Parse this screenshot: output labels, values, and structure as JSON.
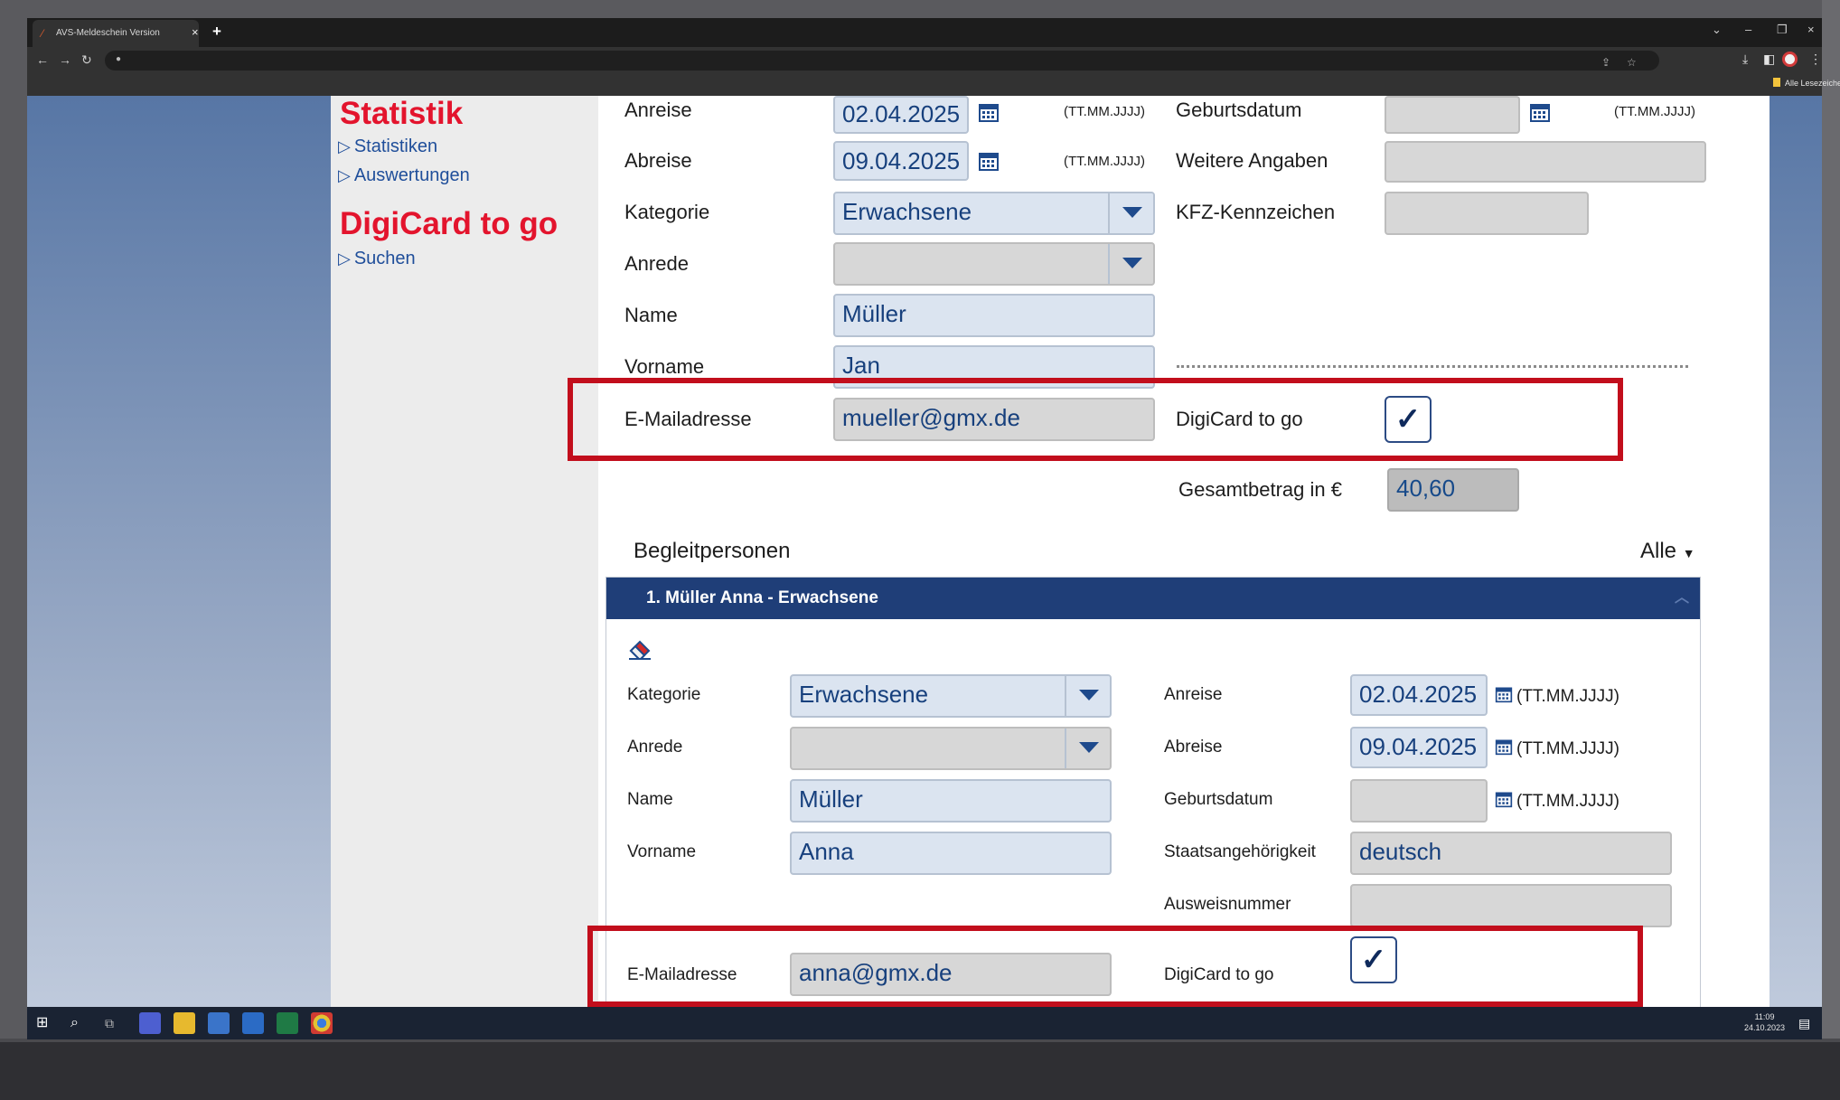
{
  "browser": {
    "tab_title": "AVS-Meldeschein Version",
    "tab_close": "×",
    "new_tab": "+",
    "window_controls": [
      "⌄",
      "–",
      "❐",
      "×"
    ],
    "bookmark_label": "Alle Lesezeichen"
  },
  "sidebar": {
    "section1_title": "Statistik",
    "section1_links": [
      "Statistiken",
      "Auswertungen"
    ],
    "section2_title": "DigiCard to go",
    "section2_links": [
      "Suchen"
    ]
  },
  "main": {
    "anreise_label": "Anreise",
    "anreise_value": "02.04.2025",
    "abreise_label": "Abreise",
    "abreise_value": "09.04.2025",
    "date_hint": "(TT.MM.JJJJ)",
    "kategorie_label": "Kategorie",
    "kategorie_value": "Erwachsene",
    "anrede_label": "Anrede",
    "anrede_value": "",
    "name_label": "Name",
    "name_value": "Müller",
    "vorname_label": "Vorname",
    "vorname_value": "Jan",
    "email_label": "E-Mailadresse",
    "email_value": "mueller@gmx.de",
    "geburtsdatum_label": "Geburtsdatum",
    "geburtsdatum_value": "",
    "weitere_label": "Weitere Angaben",
    "weitere_value": "",
    "kfz_label": "KFZ-Kennzeichen",
    "kfz_value": "",
    "digicard_label": "DigiCard to go",
    "digicard_checked": "✓",
    "gesamt_label": "Gesamtbetrag in €",
    "gesamt_value": "40,60"
  },
  "companions": {
    "title": "Begleitpersonen",
    "filter": "Alle",
    "panel_header": "1. Müller Anna - Erwachsene",
    "kategorie_label": "Kategorie",
    "kategorie_value": "Erwachsene",
    "anrede_label": "Anrede",
    "anrede_value": "",
    "name_label": "Name",
    "name_value": "Müller",
    "vorname_label": "Vorname",
    "vorname_value": "Anna",
    "email_label": "E-Mailadresse",
    "email_value": "anna@gmx.de",
    "anreise_label": "Anreise",
    "anreise_value": "02.04.2025",
    "abreise_label": "Abreise",
    "abreise_value": "09.04.2025",
    "geburtsdatum_label": "Geburtsdatum",
    "geburtsdatum_value": "",
    "date_hint": "(TT.MM.JJJJ)",
    "staat_label": "Staatsangehörigkeit",
    "staat_value": "deutsch",
    "ausweis_label": "Ausweisnummer",
    "ausweis_value": "",
    "digicard_label": "DigiCard to go",
    "digicard_checked": "✓"
  },
  "taskbar": {
    "time": "11:09",
    "date": "24.10.2023"
  },
  "colors": {
    "accent_red": "#e3142d",
    "link_blue": "#1f4e9a",
    "panel_header": "#1f3e78",
    "highlight_box": "#c20e1c"
  }
}
